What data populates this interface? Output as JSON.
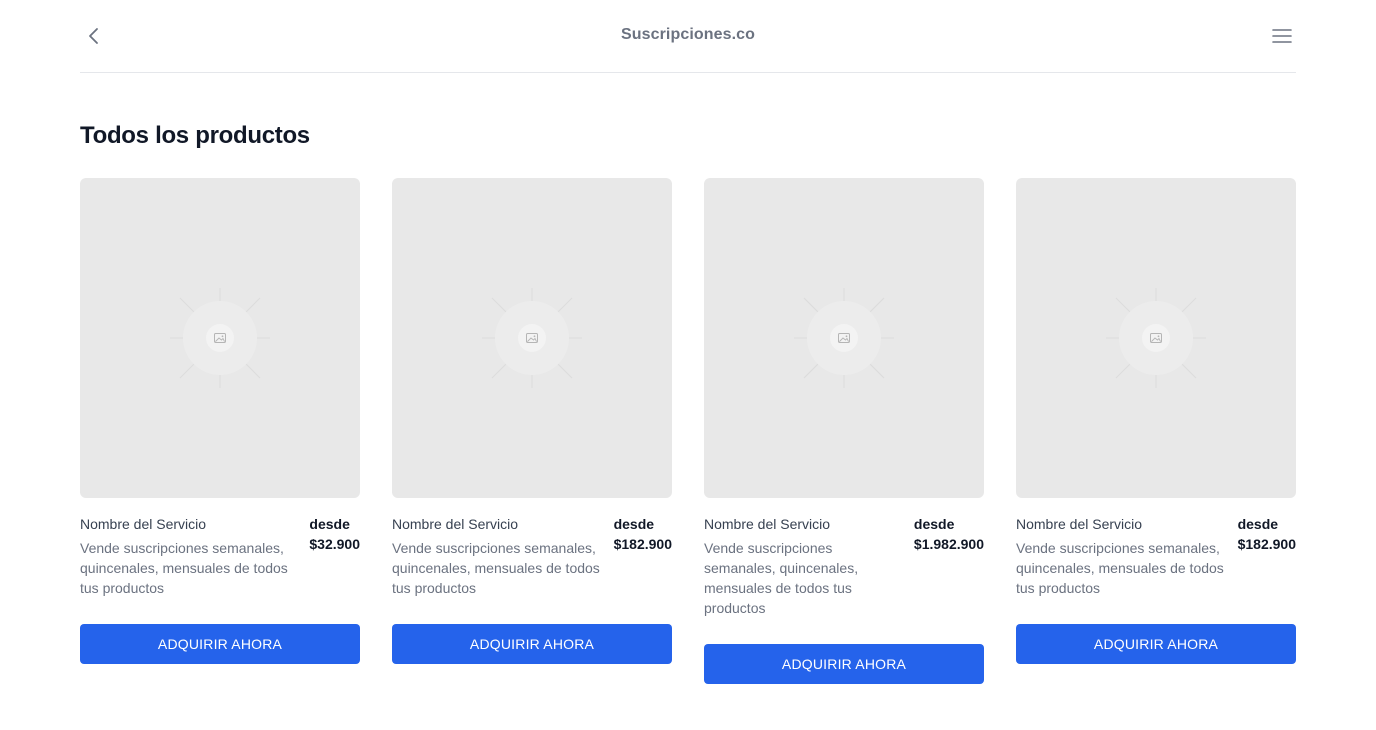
{
  "header": {
    "back_icon": "chevron-left-icon",
    "brand": "Suscripciones.co",
    "menu_icon": "hamburger-menu-icon"
  },
  "main": {
    "title": "Todos los productos"
  },
  "products": [
    {
      "name": "Nombre del Servicio",
      "description": "Vende suscripciones semanales, quincenales, mensuales de todos tus productos",
      "from_label": "desde",
      "price": "$32.900",
      "button_label": "ADQUIRIR AHORA",
      "image_icon": "image-placeholder-icon"
    },
    {
      "name": "Nombre del Servicio",
      "description": "Vende suscripciones semanales, quincenales, mensuales de todos tus productos",
      "from_label": "desde",
      "price": "$182.900",
      "button_label": "ADQUIRIR AHORA",
      "image_icon": "image-placeholder-icon"
    },
    {
      "name": "Nombre del Servicio",
      "description": "Vende suscripciones semanales, quincenales, mensuales de todos tus productos",
      "from_label": "desde",
      "price": "$1.982.900",
      "button_label": "ADQUIRIR AHORA",
      "image_icon": "image-placeholder-icon"
    },
    {
      "name": "Nombre del Servicio",
      "description": "Vende suscripciones semanales, quincenales, mensuales de todos tus productos",
      "from_label": "desde",
      "price": "$182.900",
      "button_label": "ADQUIRIR AHORA",
      "image_icon": "image-placeholder-icon"
    }
  ],
  "colors": {
    "primary": "#2563eb",
    "placeholder_bg": "#e8e8e8",
    "heading": "#111827",
    "muted_text": "#6b7280"
  }
}
